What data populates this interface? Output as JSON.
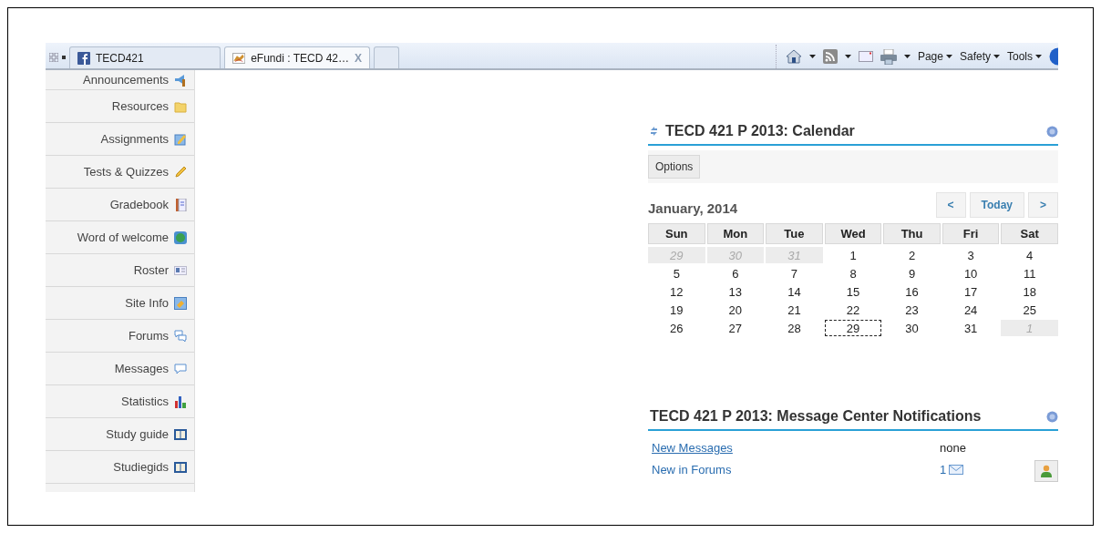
{
  "browser": {
    "tabs": [
      {
        "label": "TECD421",
        "kind": "facebook",
        "selected": false
      },
      {
        "label": "eFundi : TECD 42…",
        "kind": "efundi",
        "selected": true,
        "close": "X"
      }
    ],
    "commands": [
      {
        "kind": "home"
      },
      {
        "kind": "feed"
      },
      {
        "kind": "mail"
      },
      {
        "kind": "print"
      },
      {
        "kind": "menu",
        "label": "Page"
      },
      {
        "kind": "menu",
        "label": "Safety"
      },
      {
        "kind": "menu",
        "label": "Tools"
      },
      {
        "kind": "help"
      }
    ]
  },
  "sidebar": {
    "items": [
      {
        "label": "Announcements",
        "kind": "megaphone"
      },
      {
        "label": "Resources",
        "kind": "folder"
      },
      {
        "label": "Assignments",
        "kind": "edit"
      },
      {
        "label": "Tests & Quizzes",
        "kind": "pencil"
      },
      {
        "label": "Gradebook",
        "kind": "book"
      },
      {
        "label": "Word of welcome",
        "kind": "globe"
      },
      {
        "label": "Roster",
        "kind": "card"
      },
      {
        "label": "Site Info",
        "kind": "info"
      },
      {
        "label": "Forums",
        "kind": "bubbles"
      },
      {
        "label": "Messages",
        "kind": "bubble"
      },
      {
        "label": "Statistics",
        "kind": "chart"
      },
      {
        "label": "Study guide",
        "kind": "openbook"
      },
      {
        "label": "Studiegids",
        "kind": "openbook"
      }
    ]
  },
  "calendar": {
    "title": "TECD 421 P 2013: Calendar",
    "options": "Options",
    "prev": "<",
    "today": "Today",
    "next": ">",
    "month": "January, 2014",
    "weekdays": [
      "Sun",
      "Mon",
      "Tue",
      "Wed",
      "Thu",
      "Fri",
      "Sat"
    ],
    "weeks": [
      [
        {
          "day": "29",
          "other_month": true,
          "selected": false
        },
        {
          "day": "30",
          "other_month": true,
          "selected": false
        },
        {
          "day": "31",
          "other_month": true,
          "selected": false
        },
        {
          "day": "1",
          "other_month": false,
          "selected": false
        },
        {
          "day": "2",
          "other_month": false,
          "selected": false
        },
        {
          "day": "3",
          "other_month": false,
          "selected": false
        },
        {
          "day": "4",
          "other_month": false,
          "selected": false
        }
      ],
      [
        {
          "day": "5",
          "other_month": false,
          "selected": false
        },
        {
          "day": "6",
          "other_month": false,
          "selected": false
        },
        {
          "day": "7",
          "other_month": false,
          "selected": false
        },
        {
          "day": "8",
          "other_month": false,
          "selected": false
        },
        {
          "day": "9",
          "other_month": false,
          "selected": false
        },
        {
          "day": "10",
          "other_month": false,
          "selected": false
        },
        {
          "day": "11",
          "other_month": false,
          "selected": false
        }
      ],
      [
        {
          "day": "12",
          "other_month": false,
          "selected": false
        },
        {
          "day": "13",
          "other_month": false,
          "selected": false
        },
        {
          "day": "14",
          "other_month": false,
          "selected": false
        },
        {
          "day": "15",
          "other_month": false,
          "selected": false
        },
        {
          "day": "16",
          "other_month": false,
          "selected": false
        },
        {
          "day": "17",
          "other_month": false,
          "selected": false
        },
        {
          "day": "18",
          "other_month": false,
          "selected": false
        }
      ],
      [
        {
          "day": "19",
          "other_month": false,
          "selected": false
        },
        {
          "day": "20",
          "other_month": false,
          "selected": false
        },
        {
          "day": "21",
          "other_month": false,
          "selected": false
        },
        {
          "day": "22",
          "other_month": false,
          "selected": false
        },
        {
          "day": "23",
          "other_month": false,
          "selected": false
        },
        {
          "day": "24",
          "other_month": false,
          "selected": false
        },
        {
          "day": "25",
          "other_month": false,
          "selected": false
        }
      ],
      [
        {
          "day": "26",
          "other_month": false,
          "selected": false
        },
        {
          "day": "27",
          "other_month": false,
          "selected": false
        },
        {
          "day": "28",
          "other_month": false,
          "selected": false
        },
        {
          "day": "29",
          "other_month": false,
          "selected": true
        },
        {
          "day": "30",
          "other_month": false,
          "selected": false
        },
        {
          "day": "31",
          "other_month": false,
          "selected": false
        },
        {
          "day": "1",
          "other_month": true,
          "selected": false
        }
      ]
    ]
  },
  "notifications": {
    "title": "TECD 421 P 2013: Message Center Notifications",
    "rows": [
      {
        "label": "New Messages",
        "underlined": true,
        "value": "none",
        "kind": "text"
      },
      {
        "label": "New in Forums",
        "underlined": false,
        "value": "1",
        "kind": "mail"
      }
    ]
  }
}
